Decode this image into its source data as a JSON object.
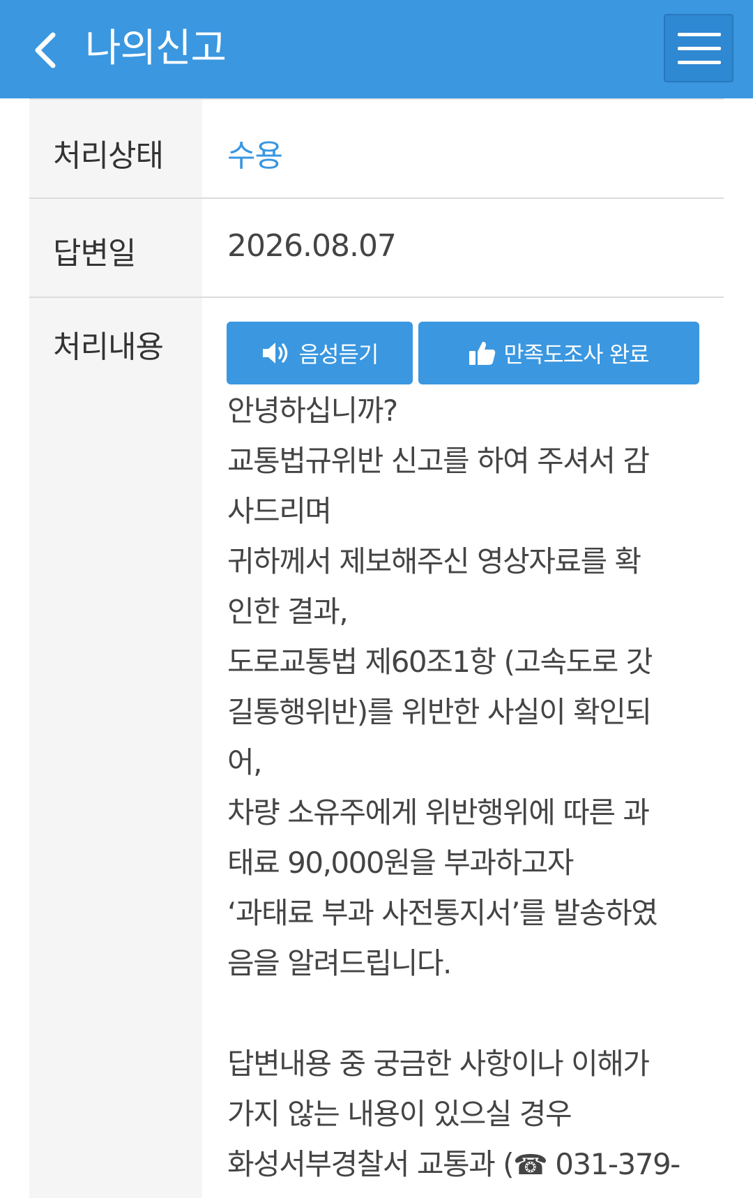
{
  "header": {
    "title": "나의신고",
    "accent_color": "#3a97e0",
    "back_icon": "chevron-left-icon",
    "menu_icon": "hamburger-icon"
  },
  "details": {
    "status_label": "처리상태",
    "status_value": "수용",
    "status_color": "#3a97e0",
    "answer_date_label": "답변일",
    "answer_date_value": "2026.08.07",
    "content_label": "처리내용"
  },
  "buttons": {
    "listen_label": "음성듣기",
    "listen_icon": "speaker-icon",
    "survey_label": "만족도조사 완료",
    "survey_icon": "thumbs-up-icon"
  },
  "answer_lines": [
    "안녕하십니까?",
    "교통법규위반 신고를 하여 주셔서 감",
    "사드리며",
    "귀하께서 제보해주신 영상자료를 확",
    "인한 결과,",
    "도로교통법 제60조1항 (고속도로 갓",
    "길통행위반)를 위반한 사실이 확인되",
    "어,",
    "차량 소유주에게 위반행위에 따른 과",
    "태료 90,000원을 부과하고자",
    "‘과태료 부과 사전통지서’를 발송하였",
    "음을 알려드립니다.",
    "",
    "답변내용 중 궁금한 사항이나 이해가",
    "가지 않는 내용이 있으실 경우",
    "화성서부경찰서 교통과 ("
  ],
  "phone": {
    "icon": "☎",
    "number": "031-379-"
  }
}
